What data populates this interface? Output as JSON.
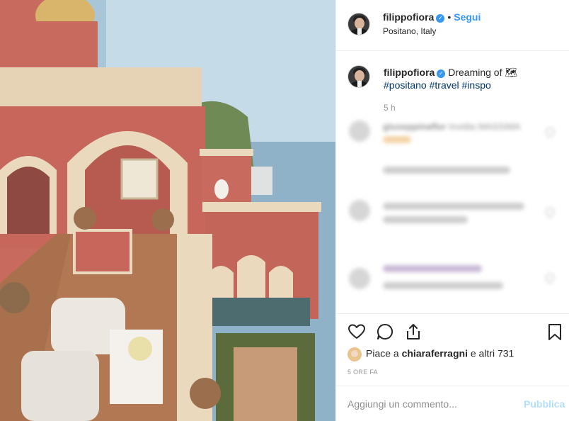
{
  "post": {
    "username": "filippofiora",
    "follow_label": "Segui",
    "separator": "•",
    "location": "Positano, Italy"
  },
  "caption": {
    "username": "filippofiora",
    "text": "Dreaming of 🗺",
    "hashtags": [
      "#positano",
      "#travel",
      "#inspo"
    ],
    "age": "5 h"
  },
  "blurred_comment": {
    "username": "giuseppinaflor",
    "text": "Invidia MASSIMA"
  },
  "likes": {
    "prefix": "Piace a",
    "user": "chiaraferragni",
    "suffix": "e altri 731"
  },
  "post_time": "5 ORE FA",
  "comment_box": {
    "placeholder": "Aggiungi un commento...",
    "publish_label": "Pubblica"
  },
  "colors": {
    "accent": "#3897f0",
    "publish_disabled": "#b2dffc",
    "hashtag": "#003569"
  },
  "icons": [
    "verified-icon",
    "heart-icon",
    "comment-icon",
    "share-icon",
    "bookmark-icon"
  ]
}
